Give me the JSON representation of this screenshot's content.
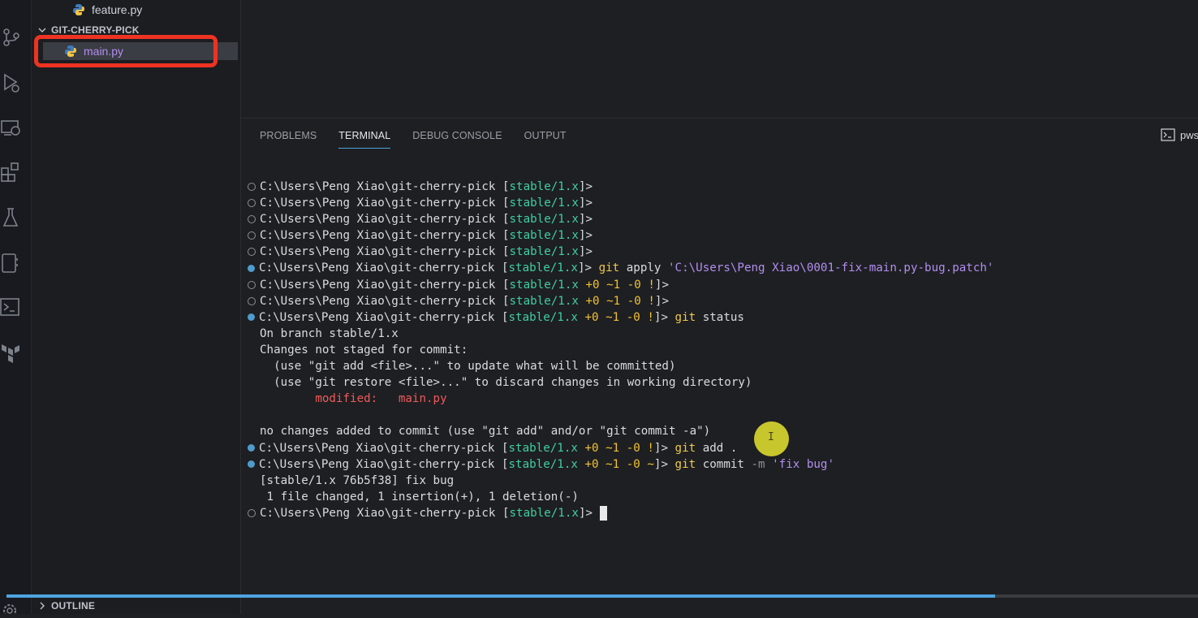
{
  "explorer": {
    "feature_file": "feature.py",
    "section_title": "GIT-CHERRY-PICK",
    "main_file": "main.py",
    "outline_title": "OUTLINE"
  },
  "panel": {
    "tabs": [
      "PROBLEMS",
      "TERMINAL",
      "DEBUG CONSOLE",
      "OUTPUT"
    ],
    "active_tab": "TERMINAL",
    "shell_label": "pws"
  },
  "terminal": {
    "prompt_path": "C:\\Users\\Peng Xiao\\git-cherry-pick",
    "lines": [
      {
        "marker": "empty",
        "type": "prompt",
        "branch": "stable/1.x",
        "status": "",
        "cmd": "",
        "args": ""
      },
      {
        "marker": "empty",
        "type": "prompt",
        "branch": "stable/1.x",
        "status": "",
        "cmd": "",
        "args": ""
      },
      {
        "marker": "empty",
        "type": "prompt",
        "branch": "stable/1.x",
        "status": "",
        "cmd": "",
        "args": ""
      },
      {
        "marker": "empty",
        "type": "prompt",
        "branch": "stable/1.x",
        "status": "",
        "cmd": "",
        "args": ""
      },
      {
        "marker": "empty",
        "type": "prompt",
        "branch": "stable/1.x",
        "status": "",
        "cmd": "",
        "args": ""
      },
      {
        "marker": "filled",
        "type": "prompt",
        "branch": "stable/1.x",
        "status": "",
        "cmd": "git apply",
        "args": "'C:\\Users\\Peng Xiao\\0001-fix-main.py-bug.patch'"
      },
      {
        "marker": "empty",
        "type": "prompt",
        "branch": "stable/1.x",
        "status": " +0 ~1 -0 !",
        "cmd": "",
        "args": ""
      },
      {
        "marker": "empty",
        "type": "prompt",
        "branch": "stable/1.x",
        "status": " +0 ~1 -0 !",
        "cmd": "",
        "args": ""
      },
      {
        "marker": "filled",
        "type": "prompt",
        "branch": "stable/1.x",
        "status": " +0 ~1 -0 !",
        "cmd": "git",
        "args": " status"
      },
      {
        "marker": "none",
        "type": "text",
        "text": "On branch stable/1.x"
      },
      {
        "marker": "none",
        "type": "text",
        "text": "Changes not staged for commit:"
      },
      {
        "marker": "none",
        "type": "text",
        "text": "  (use \"git add <file>...\" to update what will be committed)"
      },
      {
        "marker": "none",
        "type": "text",
        "text": "  (use \"git restore <file>...\" to discard changes in working directory)"
      },
      {
        "marker": "none",
        "type": "modified",
        "text": "        modified:   main.py"
      },
      {
        "marker": "none",
        "type": "text",
        "text": ""
      },
      {
        "marker": "none",
        "type": "text",
        "text": "no changes added to commit (use \"git add\" and/or \"git commit -a\")"
      },
      {
        "marker": "filled",
        "type": "prompt",
        "branch": "stable/1.x",
        "status": " +0 ~1 -0 !",
        "cmd": "git",
        "args": " add ."
      },
      {
        "marker": "filled",
        "type": "prompt_commit",
        "branch": "stable/1.x",
        "status": " +0 ~1 -0 ~",
        "cmd": "git",
        "args": " commit",
        "flag": " -m",
        "str": " 'fix bug'"
      },
      {
        "marker": "none",
        "type": "text",
        "text": "[stable/1.x 76b5f38] fix bug"
      },
      {
        "marker": "none",
        "type": "text",
        "text": " 1 file changed, 1 insertion(+), 1 deletion(-)"
      },
      {
        "marker": "empty",
        "type": "prompt_cursor",
        "branch": "stable/1.x",
        "status": "",
        "cmd": "",
        "args": ""
      }
    ]
  },
  "cursor_label": "I",
  "progress": {
    "fraction": 0.83
  },
  "colors": {
    "accent": "#4fa3e0",
    "highlight": "#ee3322",
    "branch": "#3fcfa0",
    "status": "#f1c232"
  }
}
